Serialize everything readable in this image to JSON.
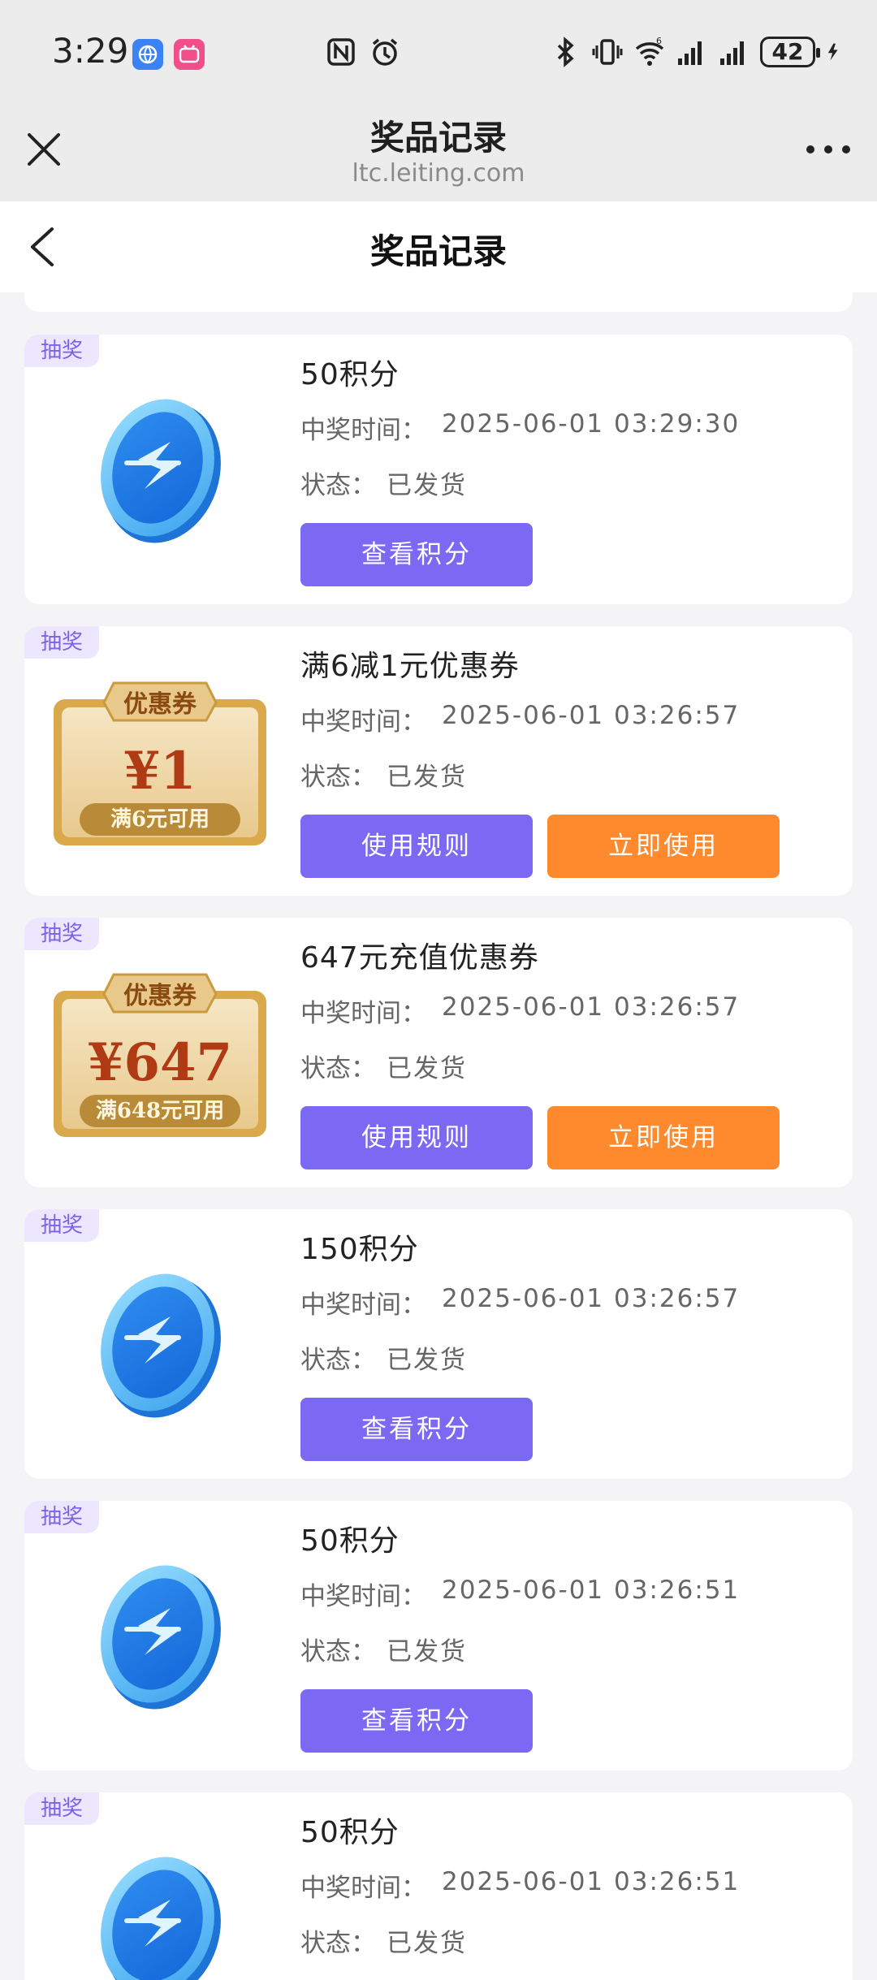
{
  "status_bar": {
    "time": "3:29",
    "battery": "42",
    "network_superscript": "6"
  },
  "browser": {
    "title": "奖品记录",
    "url": "ltc.leiting.com"
  },
  "page": {
    "title": "奖品记录"
  },
  "labels": {
    "time_label": "中奖时间：",
    "status_label": "状态："
  },
  "records": [
    {
      "tag": "抽奖",
      "name": "50积分",
      "time": "2025-06-01 03:29:30",
      "status": "已发货",
      "thumb": "points-coin-icon",
      "buttons": [
        "查看积分"
      ]
    },
    {
      "tag": "抽奖",
      "name": "满6减1元优惠券",
      "time": "2025-06-01 03:26:57",
      "status": "已发货",
      "thumb": "coupon",
      "coupon": {
        "title": "优惠券",
        "amount": "¥1",
        "condition": "满6元可用"
      },
      "buttons": [
        "使用规则",
        "立即使用"
      ]
    },
    {
      "tag": "抽奖",
      "name": "647元充值优惠券",
      "time": "2025-06-01 03:26:57",
      "status": "已发货",
      "thumb": "coupon",
      "coupon": {
        "title": "优惠券",
        "amount": "¥647",
        "condition": "满648元可用"
      },
      "buttons": [
        "使用规则",
        "立即使用"
      ]
    },
    {
      "tag": "抽奖",
      "name": "150积分",
      "time": "2025-06-01 03:26:57",
      "status": "已发货",
      "thumb": "points-coin-icon",
      "buttons": [
        "查看积分"
      ]
    },
    {
      "tag": "抽奖",
      "name": "50积分",
      "time": "2025-06-01 03:26:51",
      "status": "已发货",
      "thumb": "points-coin-icon",
      "buttons": [
        "查看积分"
      ]
    },
    {
      "tag": "抽奖",
      "name": "50积分",
      "time": "2025-06-01 03:26:51",
      "status": "已发货",
      "thumb": "points-coin-icon",
      "buttons": []
    }
  ],
  "colors": {
    "primary_button": "#7b69f4",
    "secondary_button": "#fe8a2d",
    "tag_text": "#7b62e8",
    "tag_bg": "#ece7ff"
  }
}
